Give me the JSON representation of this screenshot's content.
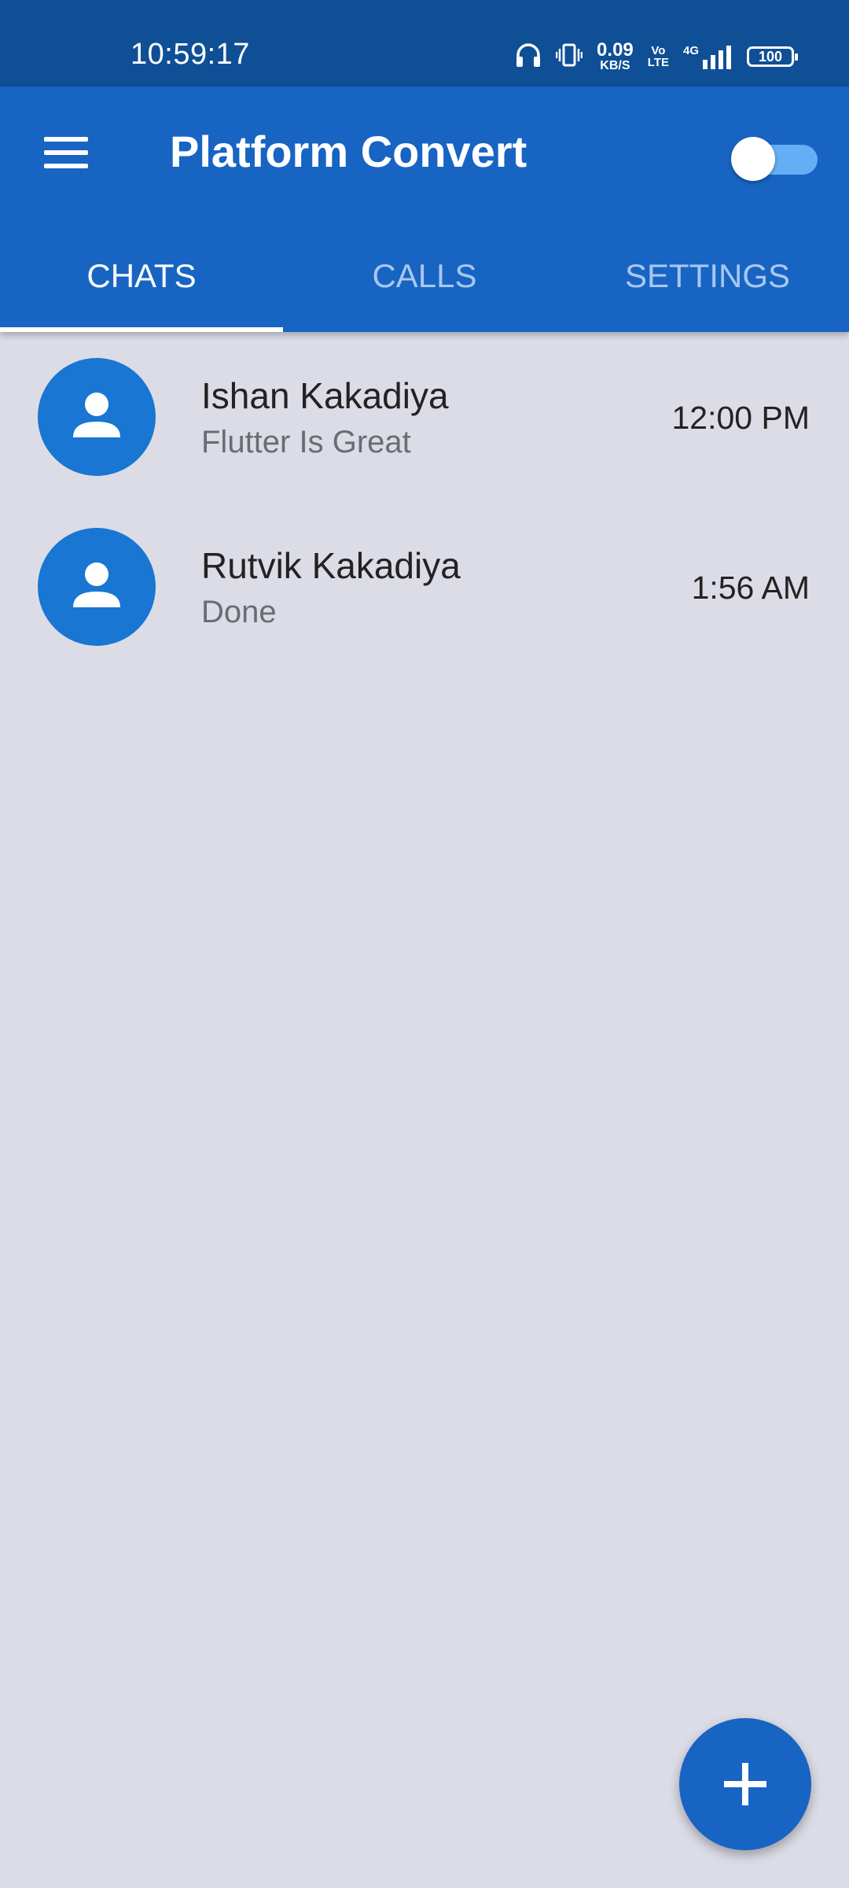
{
  "status_bar": {
    "time": "10:59:17",
    "speed_value": "0.09",
    "speed_unit": "KB/S",
    "volte_top": "Vo",
    "volte_bottom": "LTE",
    "network": "4G",
    "battery": "100",
    "icons": [
      "headphones-icon",
      "vibrate-icon",
      "signal-icon",
      "battery-icon"
    ]
  },
  "app_bar": {
    "title": "Platform Convert",
    "menu_icon": "menu-icon",
    "toggle_on": true
  },
  "tabs": [
    {
      "label": "CHATS",
      "active": true
    },
    {
      "label": "CALLS",
      "active": false
    },
    {
      "label": "SETTINGS",
      "active": false
    }
  ],
  "chats": [
    {
      "name": "Ishan Kakadiya",
      "message": "Flutter Is Great",
      "time": "12:00 PM",
      "avatar_icon": "person-icon"
    },
    {
      "name": "Rutvik Kakadiya",
      "message": "Done",
      "time": "1:56 AM",
      "avatar_icon": "person-icon"
    }
  ],
  "fab": {
    "icon": "add-icon"
  },
  "colors": {
    "status_bar": "#0f4f96",
    "app_bar": "#1764c3",
    "avatar": "#1976d2",
    "background": "#dcdce6",
    "toggle_track": "#64aef5"
  }
}
